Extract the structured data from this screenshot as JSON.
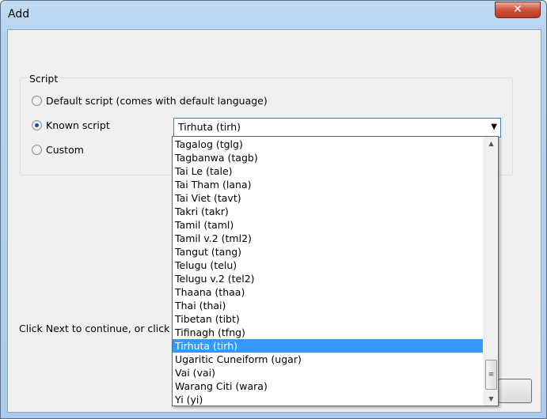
{
  "window": {
    "title": "Add",
    "close_icon": "close-icon"
  },
  "group": {
    "label": "Script"
  },
  "radios": [
    {
      "label": "Default script (comes with default language)",
      "checked": false
    },
    {
      "label": "Known script",
      "checked": true
    },
    {
      "label": "Custom",
      "checked": false
    }
  ],
  "combo": {
    "value": "Tirhuta (tirh)"
  },
  "hint": "Click Next to continue, or click C",
  "list": {
    "items": [
      "Tagalog (tglg)",
      "Tagbanwa (tagb)",
      "Tai Le (tale)",
      "Tai Tham  (lana)",
      "Tai Viet (tavt)",
      "Takri (takr)",
      "Tamil (taml)",
      "Tamil v.2 (tml2)",
      "Tangut (tang)",
      "Telugu (telu)",
      "Telugu v.2 (tel2)",
      "Thaana (thaa)",
      "Thai (thai)",
      "Tibetan (tibt)",
      "Tifinagh (tfng)",
      "Tirhuta (tirh)",
      "Ugaritic Cuneiform (ugar)",
      "Vai (vai)",
      "Warang Citi (wara)",
      "Yi (yi)"
    ],
    "selected": "Tirhuta (tirh)"
  }
}
